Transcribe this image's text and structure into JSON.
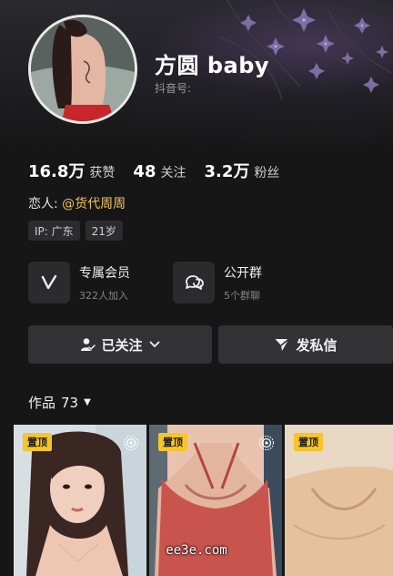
{
  "profile": {
    "nickname": "方圆 baby",
    "douyin_id_label": "抖音号:"
  },
  "stats": [
    {
      "value": "16.8万",
      "label": "获赞"
    },
    {
      "value": "48",
      "label": "关注"
    },
    {
      "value": "3.2万",
      "label": "粉丝"
    }
  ],
  "lover": {
    "label": "恋人:",
    "mention": "@货代周周"
  },
  "tags": [
    "IP: 广东",
    "21岁"
  ],
  "features": [
    {
      "title": "专属会员",
      "subtitle": "322人加入",
      "icon": "v-icon"
    },
    {
      "title": "公开群",
      "subtitle": "5个群聊",
      "icon": "chat-bubbles-icon"
    }
  ],
  "actions": {
    "follow_label": "已关注",
    "message_label": "发私信"
  },
  "works": {
    "label": "作品",
    "count": "73"
  },
  "thumbnails": [
    {
      "pin_label": "置顶"
    },
    {
      "pin_label": "置顶"
    },
    {
      "pin_label": "置顶"
    }
  ],
  "watermark": "ee3e.com",
  "colors": {
    "background": "#161616",
    "mention": "#f2c45e",
    "pin_badge": "#f5c52a",
    "button": "#333336"
  }
}
